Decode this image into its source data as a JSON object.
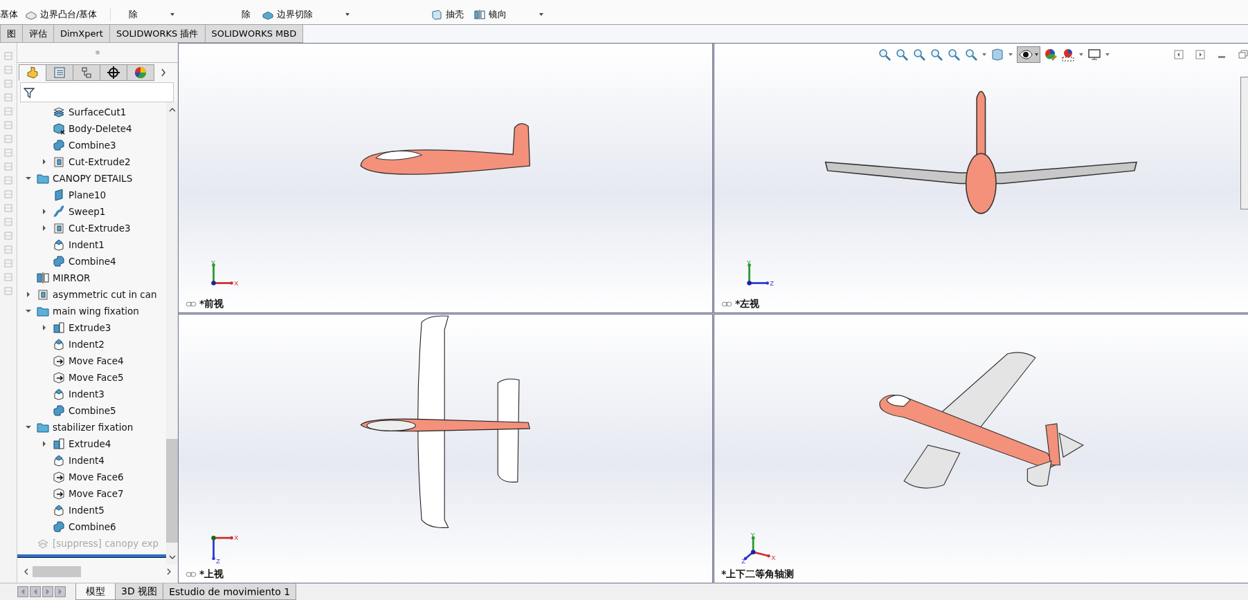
{
  "ribbon": {
    "commands": [
      {
        "label": "基体",
        "kind": "text"
      },
      {
        "label": "边界凸台/基体",
        "kind": "boss"
      },
      {
        "label": "除",
        "kind": "text"
      },
      {
        "label": "除",
        "kind": "text"
      },
      {
        "label": "边界切除",
        "kind": "cut"
      },
      {
        "label": "抽壳",
        "kind": "shell"
      },
      {
        "label": "镜向",
        "kind": "mirror"
      }
    ]
  },
  "tabs": [
    {
      "label": "图",
      "selected": false
    },
    {
      "label": "评估",
      "selected": false
    },
    {
      "label": "DimXpert",
      "selected": false
    },
    {
      "label": "SOLIDWORKS 插件",
      "selected": false
    },
    {
      "label": "SOLIDWORKS MBD",
      "selected": false
    }
  ],
  "panel_tabs": [
    {
      "kind": "features",
      "selected": true
    },
    {
      "kind": "properties",
      "selected": false
    },
    {
      "kind": "configurations",
      "selected": false
    },
    {
      "kind": "dimxpert",
      "selected": false
    },
    {
      "kind": "display",
      "selected": false
    }
  ],
  "tree": {
    "continued_items": [
      {
        "label": "SurfaceCut1",
        "kind": "surface-cut"
      },
      {
        "label": "Body-Delete4",
        "kind": "body-delete"
      },
      {
        "label": "Combine3",
        "kind": "combine"
      },
      {
        "label": "Cut-Extrude2",
        "kind": "cut-extrude",
        "expanded": false
      }
    ],
    "items": [
      {
        "label": "CANOPY DETAILS",
        "kind": "folder",
        "expanded": true,
        "children": [
          {
            "label": "Plane10",
            "kind": "plane"
          },
          {
            "label": "Sweep1",
            "kind": "sweep",
            "expanded": false
          },
          {
            "label": "Cut-Extrude3",
            "kind": "cut-extrude",
            "expanded": false
          },
          {
            "label": "Indent1",
            "kind": "indent"
          },
          {
            "label": "Combine4",
            "kind": "combine"
          }
        ]
      },
      {
        "label": "MIRROR",
        "kind": "mirror"
      },
      {
        "label": "asymmetric cut in can",
        "kind": "cut-extrude",
        "expanded": false
      },
      {
        "label": "main wing fixation",
        "kind": "folder",
        "expanded": true,
        "children": [
          {
            "label": "Extrude3",
            "kind": "extrude",
            "expanded": false
          },
          {
            "label": "Indent2",
            "kind": "indent"
          },
          {
            "label": "Move Face4",
            "kind": "move-face"
          },
          {
            "label": "Move Face5",
            "kind": "move-face"
          },
          {
            "label": "Indent3",
            "kind": "indent"
          },
          {
            "label": "Combine5",
            "kind": "combine"
          }
        ]
      },
      {
        "label": "stabilizer fixation",
        "kind": "folder",
        "expanded": true,
        "children": [
          {
            "label": "Extrude4",
            "kind": "extrude",
            "expanded": false
          },
          {
            "label": "Indent4",
            "kind": "indent"
          },
          {
            "label": "Move Face6",
            "kind": "move-face"
          },
          {
            "label": "Move Face7",
            "kind": "move-face"
          },
          {
            "label": "Indent5",
            "kind": "indent"
          },
          {
            "label": "Combine6",
            "kind": "combine"
          }
        ]
      },
      {
        "label": "[suppress] canopy exp",
        "kind": "suppressed"
      }
    ]
  },
  "view_toolbar": {
    "hide_show_pressed": true
  },
  "viewports": [
    {
      "label": "*前视",
      "kind": "front",
      "triad_labels": [
        "Y",
        "X"
      ]
    },
    {
      "label": "*左视",
      "kind": "left",
      "triad_labels": [
        "Y",
        "Z"
      ]
    },
    {
      "label": "*上视",
      "kind": "top",
      "triad_labels": [
        "X",
        "Z"
      ]
    },
    {
      "label": "*上下二等角轴测",
      "kind": "iso",
      "triad_labels": [
        "Y",
        "Z",
        "X"
      ]
    }
  ],
  "bottom_tabs": [
    {
      "label": "模型",
      "selected": true
    },
    {
      "label": "3D 视图",
      "selected": false
    },
    {
      "label": "Estudio de movimiento 1",
      "selected": false
    }
  ]
}
